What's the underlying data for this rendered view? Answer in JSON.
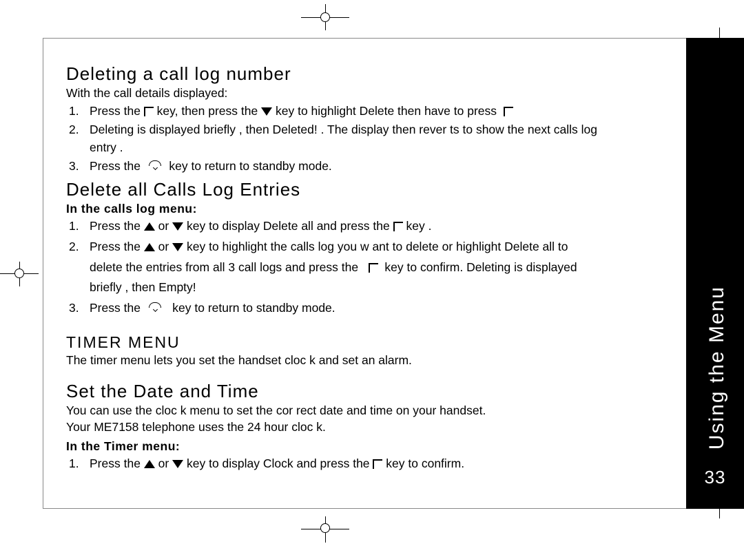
{
  "tab": {
    "label": "Using the Menu",
    "page": "33"
  },
  "s1": {
    "title": "Deleting a call log number",
    "intro": "With the call details displayed:",
    "i1a": "Press the ",
    "i1b": " key, then press the ",
    "i1c": " key to highlight Delete then have to press ",
    "i2": "Deleting  is displayed briefly  , then Deleted!  . The display then rever  ts to show the next calls log entry  .",
    "i3a": "Press the ",
    "i3b": " key to return to standby mode."
  },
  "s2": {
    "title": "Delete all Calls Log Entries",
    "intro": "In the calls log menu:",
    "i1a": "Press the ",
    "i1b": " or ",
    "i1c": " key to display Delete all   and press the ",
    "i1d": " key  .",
    "i2a": "Press the ",
    "i2b": " or ",
    "i2c": " key to highlight the calls log you w    ant to delete or highlight Delete  all to delete the entries from all 3 call logs and press the ",
    "i2d": " key to confirm. Deleting   is displayed briefly  , then Empty!",
    "i3a": "Press the ",
    "i3b": " key to return to standby mode."
  },
  "s3": {
    "title": "TIMER MENU",
    "intro": "The timer menu lets you set the handset cloc    k and set an alarm."
  },
  "s4": {
    "title": "Set the Date and Time",
    "p1": "You can use the cloc k menu to set the cor  rect date and time on your handset.",
    "p2": "Your ME7158 telephone uses the 24 hour cloc   k.",
    "intro": "In the Timer menu:",
    "i1a": "Press the ",
    "i1b": " or ",
    "i1c": " key to display Clock   and press the ",
    "i1d": " key to confirm."
  }
}
